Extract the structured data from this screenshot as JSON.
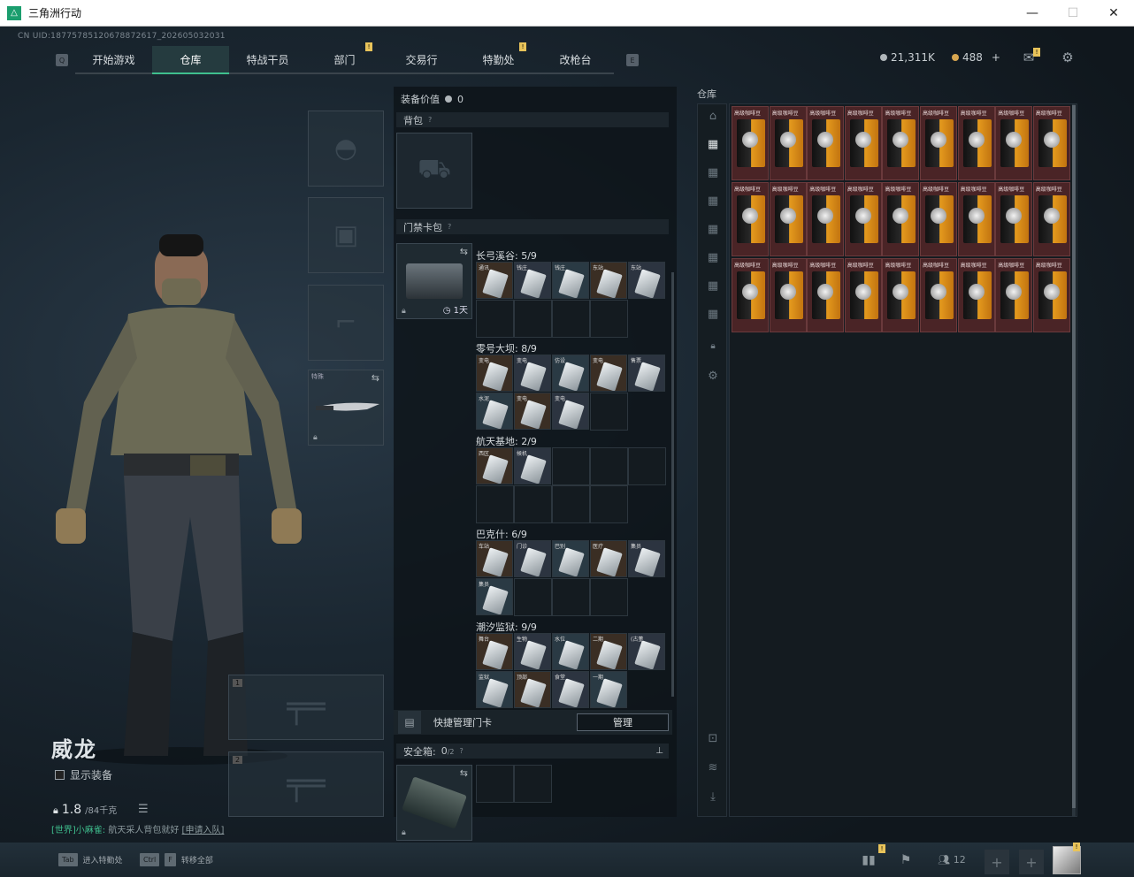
{
  "window": {
    "title": "三角洲行动",
    "minimize": "—",
    "maximize": "☐",
    "close": "✕"
  },
  "uid": "CN UID:18775785120678872617_202605032031",
  "nav": {
    "tabs": [
      {
        "label": "开始游戏",
        "active": false
      },
      {
        "label": "仓库",
        "active": true
      },
      {
        "label": "特战干员",
        "active": false
      },
      {
        "label": "部门",
        "active": false,
        "badge": "!"
      },
      {
        "label": "交易行",
        "active": false
      },
      {
        "label": "特勤处",
        "active": false,
        "badge": "!"
      },
      {
        "label": "改枪台",
        "active": false
      }
    ],
    "left_key": "Q",
    "right_key": "E"
  },
  "currency": {
    "silver": "21,311K",
    "gold": "488",
    "plus": "+"
  },
  "character": {
    "name": "威龙",
    "show_equipment": "显示装备",
    "weight": "1.8",
    "weight_max": "/84千克",
    "melee_label": "特殊",
    "weapon_slot1": "1",
    "weapon_slot2": "2"
  },
  "chat": {
    "channel": "[世界]小麻雀:",
    "message": "航天采人背包就好",
    "link": "[申请入队]"
  },
  "mid": {
    "equip_value_label": "装备价值",
    "equip_value": "0",
    "backpack_label": "背包",
    "keycard_label": "门禁卡包",
    "pass_timer": "1天",
    "groups": [
      {
        "label": "长弓溪谷: 5/9",
        "cards": [
          "通讯",
          "钱庄",
          "钱庄",
          "东站",
          "东站"
        ]
      },
      {
        "label": "零号大坝: 8/9",
        "cards": [
          "变电",
          "变电",
          "仿设",
          "变电",
          "售票",
          "水泥",
          "变电",
          "变电"
        ]
      },
      {
        "label": "航天基地: 2/9",
        "cards": [
          "西区",
          "候机"
        ]
      },
      {
        "label": "巴克什: 6/9",
        "cards": [
          "车站",
          "门诊",
          "巴别",
          "医疗",
          "集员",
          "集员"
        ]
      },
      {
        "label": "潮汐监狱: 9/9",
        "cards": [
          "舞台",
          "生物",
          "水位",
          "二期",
          "(古董",
          "监狱",
          "顶部",
          "食堂",
          "一期"
        ]
      }
    ],
    "quick_manage": "快捷管理门卡",
    "manage_button": "管理",
    "safebox_label": "安全箱:",
    "safebox_count": "0",
    "safebox_max": "/2"
  },
  "warehouse": {
    "title": "仓库",
    "item_label": "高级咖啡豆",
    "item_count": 27,
    "colors": {
      "item_bg": "#4a2426",
      "accent": "#3fbf8e"
    }
  },
  "bottom": {
    "tab_key": "Tab",
    "tab_hint": "进入特勤处",
    "ctrl_key": "Ctrl",
    "f_key": "F",
    "ctrl_hint": "转移全部",
    "friends": "12",
    "add": "+"
  },
  "icons": [
    "close-icon",
    "settings-gear-icon",
    "mail-icon",
    "lock-icon",
    "swap-icon",
    "clock-icon",
    "helmet-icon",
    "armor-icon",
    "pistol-icon",
    "rifle-icon",
    "knife-icon",
    "backpack-icon",
    "safebox-icon",
    "list-icon",
    "chart-icon",
    "flag-icon",
    "friends-icon",
    "avatar-icon"
  ]
}
